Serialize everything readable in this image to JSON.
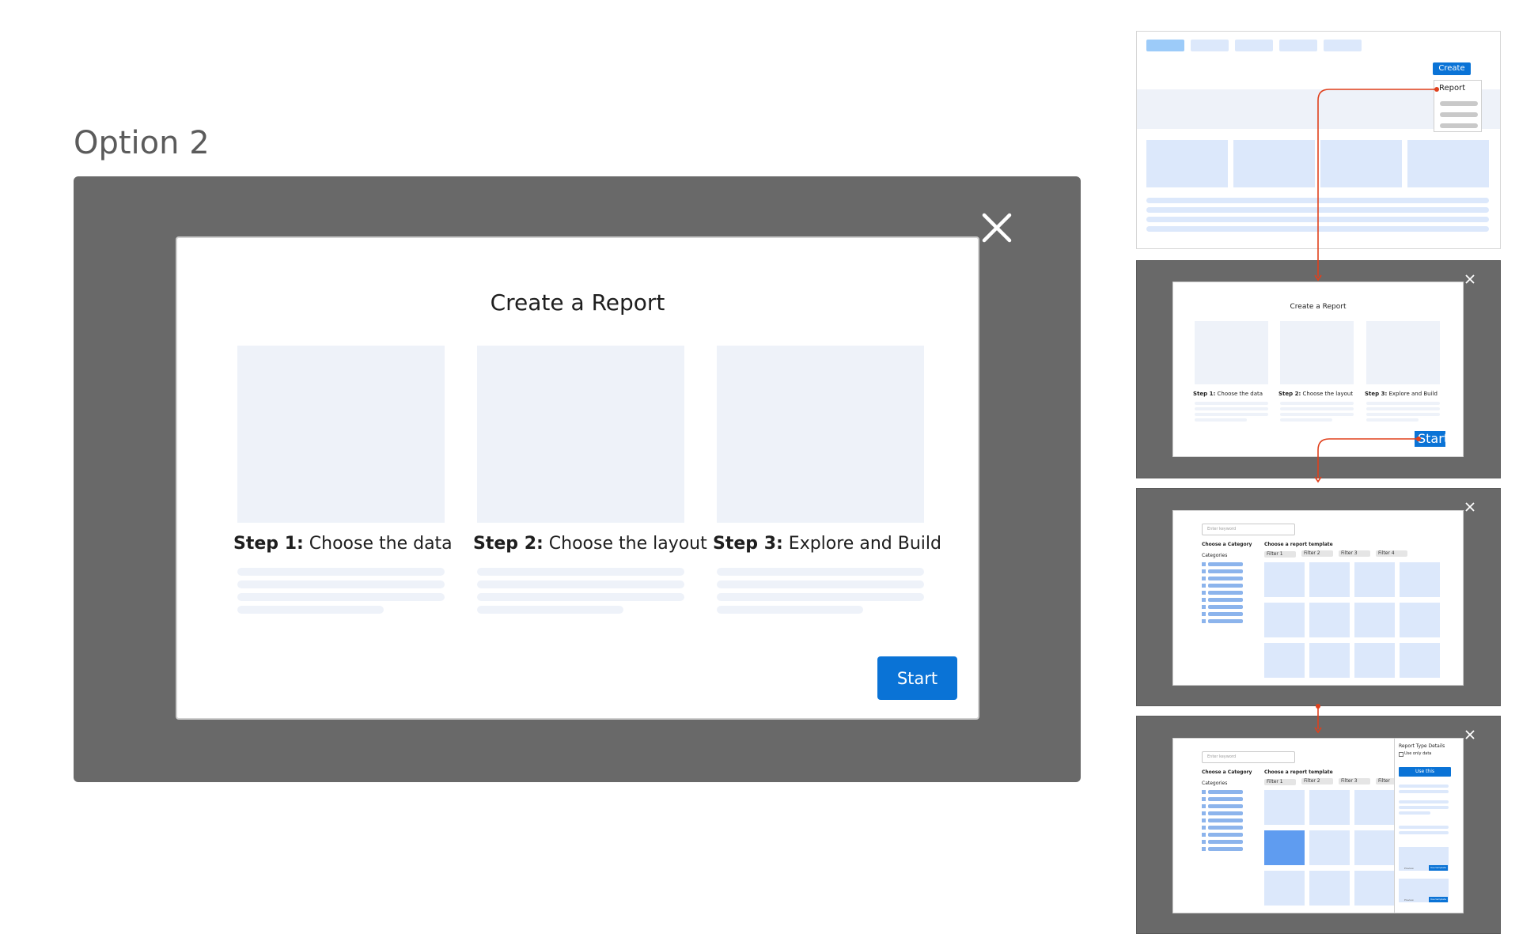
{
  "option": {
    "title": "Option 2"
  },
  "modal": {
    "heading": "Create a Report",
    "steps": [
      {
        "label": "Step 1:",
        "text": " Choose the data"
      },
      {
        "label": "Step 2:",
        "text": " Choose the layout"
      },
      {
        "label": "Step 3:",
        "text": " Explore and Build"
      }
    ],
    "start_label": "Start"
  },
  "thumb1": {
    "create_label": "Create",
    "menu_item": "Report"
  },
  "thumb2": {
    "heading": "Create a Report",
    "steps": [
      {
        "label": "Step 1:",
        "text": " Choose the data"
      },
      {
        "label": "Step 2:",
        "text": " Choose the layout"
      },
      {
        "label": "Step 3:",
        "text": " Explore and Build"
      }
    ],
    "start_label": "Start"
  },
  "thumb3": {
    "search_placeholder": "Enter keyword",
    "category_heading": "Choose a Category",
    "categories_label": "Categories",
    "template_heading": "Choose a report template",
    "filters": [
      "Filter 1",
      "Filter 2",
      "Filter 3",
      "Filter 4"
    ]
  },
  "thumb4": {
    "search_placeholder": "Enter keyword",
    "category_heading": "Choose a Category",
    "categories_label": "Categories",
    "template_heading": "Choose a report template",
    "filters": [
      "Filter 1",
      "Filter 2",
      "Filter 3",
      "Filter"
    ],
    "panel_title": "Report Type Details",
    "checkbox_label": "Use only data",
    "use_button": "Use this",
    "mini_preview": "Preview",
    "mini_use": "Use template"
  },
  "colors": {
    "overlay": "#696969",
    "accent": "#0a73d6",
    "placeholder": "#eef2f9",
    "light_blue": "#dce8fb",
    "flow_arrow": "#e0401c"
  }
}
